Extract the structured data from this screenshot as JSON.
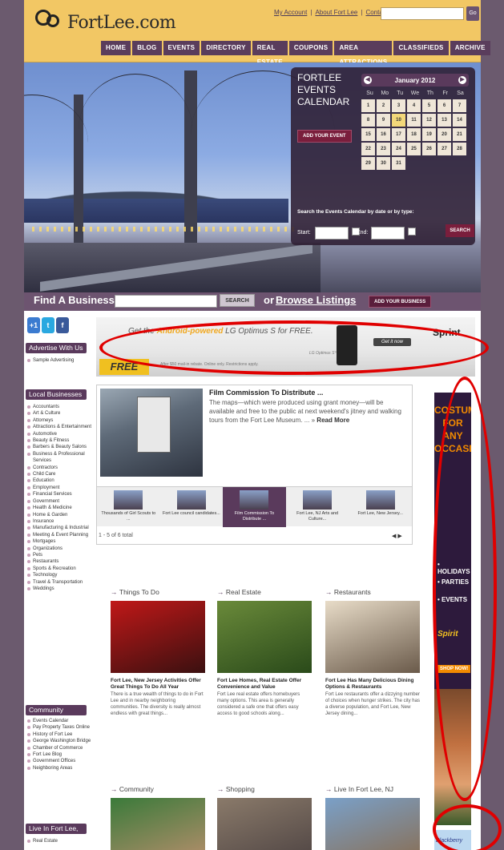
{
  "header": {
    "logo_text": "FortLee.com",
    "top_links": [
      "My Account",
      "About Fort Lee",
      "Contact Us"
    ],
    "search_button": "Go",
    "nav": [
      "HOME",
      "BLOG",
      "EVENTS",
      "DIRECTORY",
      "REAL ESTATE",
      "COUPONS",
      "AREA ATTRACTIONS",
      "CLASSIFIEDS",
      "ARCHIVE"
    ]
  },
  "events": {
    "title_line1": "FORTLEE",
    "title_line2": "EVENTS",
    "title_line3": "CALENDAR",
    "add_event": "ADD YOUR EVENT",
    "month": "January 2012",
    "prev": "◀",
    "next": "▶",
    "days_of_week": [
      "Su",
      "Mo",
      "Tu",
      "We",
      "Th",
      "Fr",
      "Sa"
    ],
    "days": [
      "1",
      "2",
      "3",
      "4",
      "5",
      "6",
      "7",
      "8",
      "9",
      "10",
      "11",
      "12",
      "13",
      "14",
      "15",
      "16",
      "17",
      "18",
      "19",
      "20",
      "21",
      "22",
      "23",
      "24",
      "25",
      "26",
      "27",
      "28",
      "29",
      "30",
      "31"
    ],
    "today": "10",
    "search_label": "Search the Events Calendar by date or by type:",
    "start_label": "Start:",
    "end_label": "End:",
    "search_button": "SEARCH"
  },
  "find": {
    "label": "Find A Business",
    "search_button": "SEARCH",
    "or": "or",
    "browse": "Browse Listings",
    "add_business": "ADD YOUR BUSINESS"
  },
  "sidebar": {
    "social": [
      "+1",
      "t",
      "f"
    ],
    "advertise_head": "Advertise With Us",
    "advertise_items": [
      "Sample Advertising"
    ],
    "local_head": "Local Businesses",
    "local_items": [
      "Accountants",
      "Art & Culture",
      "Attorneys",
      "Attractions & Entertainment",
      "Automotive",
      "Beauty & Fitness",
      "Barbers & Beauty Salons",
      "Business & Professional Services",
      "Contractors",
      "Child Care",
      "Education",
      "Employment",
      "Financial Services",
      "Government",
      "Health & Medicine",
      "Home & Garden",
      "Insurance",
      "Manufacturing & Industrial",
      "Meeting & Event Planning",
      "Mortgages",
      "Organizations",
      "Pets",
      "Restaurants",
      "Sports & Recreation",
      "Technology",
      "Travel & Transportation",
      "Weddings"
    ],
    "community_head": "Community",
    "community_items": [
      "Events Calendar",
      "Pay Property Taxes Online",
      "History of Fort Lee",
      "George Washington Bridge",
      "Chamber of Commerce",
      "Fort Lee Blog",
      "Government Offices",
      "Neighboring Areas"
    ],
    "live_head": "Live In Fort Lee, NJ",
    "live_items": [
      "Real Estate"
    ]
  },
  "ad_banner": {
    "line_pre": "Get the",
    "line_hl": "Android-powered",
    "line_post": "LG Optimus S for FREE.",
    "free": "FREE",
    "fine_print": "After $50 mail-in rebate. Online only. Restrictions apply.",
    "model": "LG Optimus S™",
    "cta": "Get it now",
    "brand": "Sprint"
  },
  "feature": {
    "title": "Film Commission To Distribute ...",
    "text": "The maps—which were produced using grant money—will be available and free to the public at next weekend's jitney and walking tours from the Fort Lee Museum. ... »",
    "more": "Read More",
    "thumbs": [
      "Thousands of Girl Scouts to ...",
      "Fort Lee council candidates...",
      "Film Commission To Distribute ...",
      "Fort Lee, NJ Arts and Culture...",
      "Fort Lee, New Jersey..."
    ],
    "active_thumb": 2,
    "count": "1 - 5 of 6 total",
    "arrows": "◀   ▶"
  },
  "sky_ad": {
    "head": "COSTUMES FOR ANY OCCASION!",
    "bullets": [
      "• HOLIDAYS",
      "• PARTIES",
      "• EVENTS"
    ],
    "brand": "Spirit",
    "shop": "SHOP NOW!"
  },
  "bb_ad": {
    "text": "Blackberry"
  },
  "cards": [
    {
      "head": "Things To Do",
      "title": "Fort Lee, New Jersey Activities Offer Great Things To Do All Year",
      "text": "There is a true wealth of things to do in Fort Lee and in nearby neighboring communities. The diversity is really almost endless with great things...",
      "color_a": "#c01818",
      "color_b": "#3a1010"
    },
    {
      "head": "Real Estate",
      "title": "Fort Lee Homes, Real Estate Offer Convenience and Value",
      "text": "Fort Lee real estate offers homebuyers many options. This area is generally considered a safe one that offers easy access to good schools along...",
      "color_a": "#6a8a3a",
      "color_b": "#2a4a1a"
    },
    {
      "head": "Restaurants",
      "title": "Fort Lee Has Many Delicious Dining Options & Restaurants",
      "text": "Fort Lee restaurants offer a dizzying number of choices when hunger strikes. The city has a diverse population, and Fort Lee, New Jersey dining...",
      "color_a": "#e8dcc8",
      "color_b": "#6a5a4a"
    },
    {
      "head": "Community",
      "title": "",
      "text": "",
      "color_a": "#3a7a3a",
      "color_b": "#c09070"
    },
    {
      "head": "Shopping",
      "title": "",
      "text": "",
      "color_a": "#8a7a6a",
      "color_b": "#4a4040"
    },
    {
      "head": "Live In Fort Lee, NJ",
      "title": "",
      "text": "",
      "color_a": "#7aa0c8",
      "color_b": "#8a6a4a"
    }
  ],
  "colors": {
    "brand": "#5a3a5c",
    "header": "#f2c764",
    "annotation": "#e00000"
  }
}
